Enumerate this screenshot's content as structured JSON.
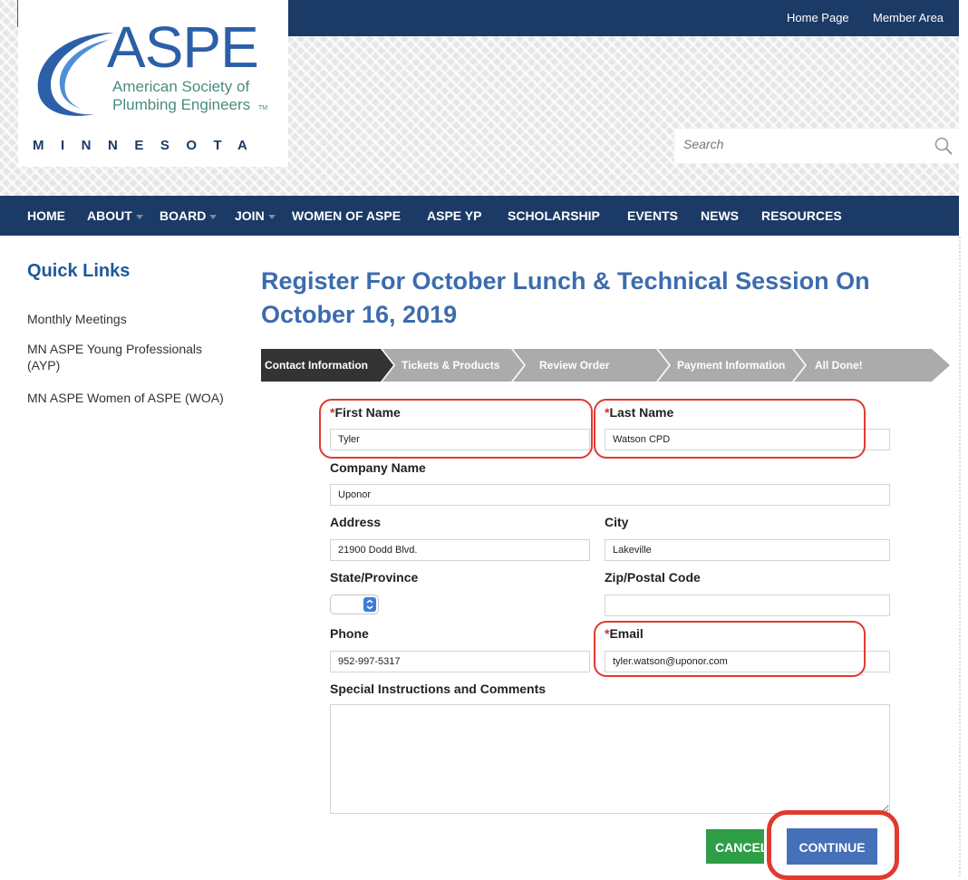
{
  "header": {
    "logo_main": "ASPE",
    "logo_line1": "American Society of",
    "logo_line2": "Plumbing Engineers",
    "logo_tm": "TM",
    "logo_state": "MINNESOTA",
    "top_links": [
      "Home Page",
      "Member Area"
    ],
    "search_placeholder": "Search"
  },
  "nav": {
    "items": [
      "HOME",
      "ABOUT",
      "BOARD",
      "JOIN",
      "WOMEN OF ASPE",
      "ASPE YP",
      "SCHOLARSHIP",
      "EVENTS",
      "NEWS",
      "RESOURCES"
    ]
  },
  "sidebar": {
    "title": "Quick Links",
    "links": [
      "Monthly Meetings",
      "MN ASPE Young Professionals (AYP)",
      "MN ASPE Women of ASPE (WOA)"
    ]
  },
  "main": {
    "title": "Register For October Lunch & Technical Session On October 16, 2019",
    "steps": [
      "Contact Information",
      "Tickets & Products",
      "Review Order",
      "Payment Information",
      "All Done!"
    ]
  },
  "form": {
    "required_mark": "*",
    "first_name_label": "First Name",
    "first_name_value": "Tyler",
    "last_name_label": "Last Name",
    "last_name_value": "Watson CPD",
    "company_label": "Company Name",
    "company_value": "Uponor",
    "address_label": "Address",
    "address_value": "21900 Dodd Blvd.",
    "city_label": "City",
    "city_value": "Lakeville",
    "state_label": "State/Province",
    "state_value": "",
    "zip_label": "Zip/Postal Code",
    "zip_value": "",
    "phone_label": "Phone",
    "phone_value": "952-997-5317",
    "email_label": "Email",
    "email_value": "tyler.watson@uponor.com",
    "comments_label": "Special Instructions and Comments",
    "cancel_label": "CANCEL",
    "continue_label": "CONTINUE"
  },
  "colors": {
    "navy": "#1b3a66",
    "title_blue": "#3c6cad",
    "highlight_red": "#e03a2e",
    "cancel_green": "#2e9e47",
    "continue_blue": "#4670b8"
  }
}
